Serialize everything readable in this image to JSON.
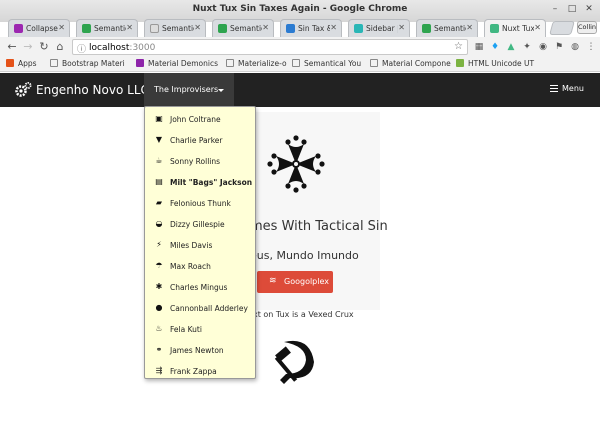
{
  "window": {
    "title": "Nuxt Tux Sin Taxes Again - Google Chrome"
  },
  "tabs": [
    {
      "label": "Collapse",
      "color": "#9c27b0",
      "active": false
    },
    {
      "label": "Semantic",
      "color": "#2ea44f",
      "active": false
    },
    {
      "label": "Semantic",
      "color": "#cccccc",
      "active": false
    },
    {
      "label": "Semantic",
      "color": "#2ea44f",
      "active": false
    },
    {
      "label": "Sin Tax &",
      "color": "#2b7bd1",
      "active": false
    },
    {
      "label": "Sidebar |",
      "color": "#29b6b6",
      "active": false
    },
    {
      "label": "Semantic",
      "color": "#2ea44f",
      "active": false
    },
    {
      "label": "Nuxt Tux",
      "color": "#41b883",
      "active": true
    }
  ],
  "profile": "Collin",
  "address": {
    "host": "localhost",
    "port": ":3000"
  },
  "bookmarks": [
    {
      "label": "Apps",
      "color": "#e5531a"
    },
    {
      "label": "Bootstrap Materi",
      "color": "#ffffff"
    },
    {
      "label": "Material Demonics",
      "color": "#8e24aa"
    },
    {
      "label": "Materialize-o",
      "color": "#ffffff"
    },
    {
      "label": "Semantical You",
      "color": "#ffffff"
    },
    {
      "label": "Material Compone",
      "color": "#ffffff"
    },
    {
      "label": "HTML Unicode UT",
      "color": "#7cb342"
    }
  ],
  "page": {
    "brand": "Engenho Novo LLC",
    "dropdown_label": "The Improvisers",
    "menu_label": "Menu",
    "heading": "emes With Tactical Sin",
    "subheading": "eus, Mundo Imundo",
    "button_label": "Googolplex",
    "tagline": "xt on Tux is a Vexed Crux"
  },
  "dropdown_items": [
    {
      "label": "John Coltrane",
      "icon": "bus-icon",
      "glyph": "▣",
      "bold": false
    },
    {
      "label": "Charlie Parker",
      "icon": "cocktail-icon",
      "glyph": "▼",
      "bold": false
    },
    {
      "label": "Sonny Rollins",
      "icon": "coffee-icon",
      "glyph": "☕",
      "bold": false
    },
    {
      "label": "Milt \"Bags\" Jackson",
      "icon": "subway-icon",
      "glyph": "▤",
      "bold": true
    },
    {
      "label": "Felonious Thunk",
      "icon": "taxi-icon",
      "glyph": "▰",
      "bold": false
    },
    {
      "label": "Dizzy Gillespie",
      "icon": "car-icon",
      "glyph": "◒",
      "bold": false
    },
    {
      "label": "Miles Davis",
      "icon": "lightning-icon",
      "glyph": "⚡",
      "bold": false
    },
    {
      "label": "Max Roach",
      "icon": "umbrella-icon",
      "glyph": "☂",
      "bold": false
    },
    {
      "label": "Charles Mingus",
      "icon": "bug-icon",
      "glyph": "✱",
      "bold": false
    },
    {
      "label": "Cannonball Adderley",
      "icon": "bomb-icon",
      "glyph": "●",
      "bold": false
    },
    {
      "label": "Fela Kuti",
      "icon": "fire-icon",
      "glyph": "♨",
      "bold": false
    },
    {
      "label": "James Newton",
      "icon": "motorcycle-icon",
      "glyph": "⚭",
      "bold": false
    },
    {
      "label": "Frank Zappa",
      "icon": "usb-icon",
      "glyph": "⇶",
      "bold": false
    }
  ],
  "colors": {
    "navbar": "#222222",
    "dropdown_bg": "#ffffd7",
    "button": "#dd4b39"
  }
}
